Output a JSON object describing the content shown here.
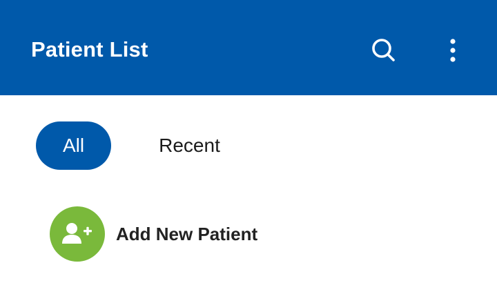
{
  "header": {
    "title": "Patient List",
    "actions": [
      {
        "icon": "search-icon"
      },
      {
        "icon": "more-vert-icon"
      }
    ]
  },
  "tabs": [
    {
      "label": "All",
      "selected": true
    },
    {
      "label": "Recent",
      "selected": false
    }
  ],
  "add_patient": {
    "label": "Add New Patient",
    "icon": "add-person-icon"
  },
  "colors": {
    "primary": "#0059aa",
    "accent_green": "#7ab93b",
    "text_dark": "#1b1b1b",
    "on_primary": "#ffffff"
  }
}
